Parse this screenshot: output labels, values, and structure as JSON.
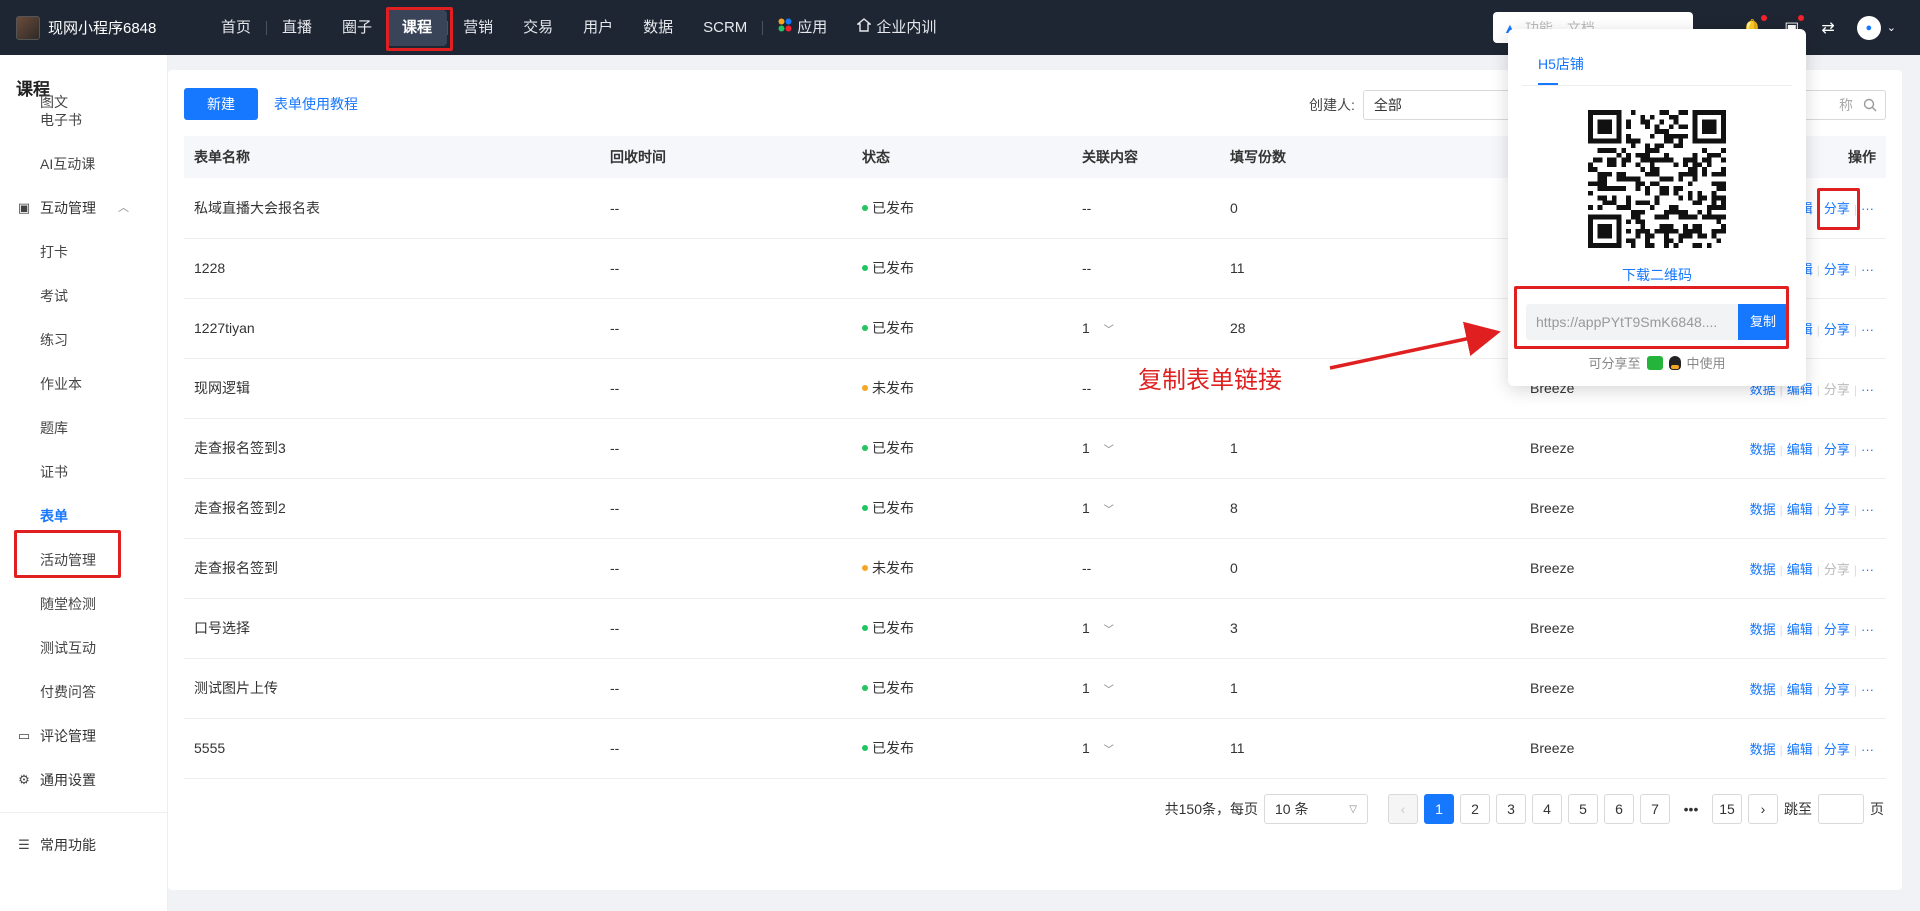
{
  "app": {
    "name": "现网小程序6848"
  },
  "nav": {
    "items": [
      {
        "label": "首页"
      },
      {
        "label": "直播"
      },
      {
        "label": "圈子"
      },
      {
        "label": "课程"
      },
      {
        "label": "营销"
      },
      {
        "label": "交易"
      },
      {
        "label": "用户"
      },
      {
        "label": "数据"
      },
      {
        "label": "SCRM"
      },
      {
        "label": "应用"
      },
      {
        "label": "企业内训"
      }
    ],
    "active": "课程",
    "search_placeholder": "功能、文档"
  },
  "sidebar": {
    "title": "课程",
    "items_top": [
      "图文",
      "电子书",
      "AI互动课"
    ],
    "group1": {
      "label": "互动管理"
    },
    "items_group1": [
      "打卡",
      "考试",
      "练习",
      "作业本",
      "题库",
      "证书",
      "表单",
      "活动管理",
      "随堂检测",
      "测试互动",
      "付费问答"
    ],
    "active": "表单",
    "group2": {
      "label": "评论管理"
    },
    "group3": {
      "label": "通用设置"
    },
    "group4": {
      "label": "常用功能"
    }
  },
  "toolbar": {
    "new_label": "新建",
    "tutorial_link": "表单使用教程",
    "creator_label": "创建人:",
    "creator_value": "全部",
    "search_placeholder": "称"
  },
  "table": {
    "headers": [
      "表单名称",
      "回收时间",
      "状态",
      "关联内容",
      "填写份数",
      "",
      "操作"
    ],
    "rows": [
      {
        "name": "私域直播大会报名表",
        "time": "--",
        "status": "已发布",
        "published": true,
        "related": "--",
        "count": "0",
        "creator": "",
        "share_enabled": true
      },
      {
        "name": "1228",
        "time": "--",
        "status": "已发布",
        "published": true,
        "related": "--",
        "count": "11",
        "creator": "",
        "share_enabled": true
      },
      {
        "name": "1227tiyan",
        "time": "--",
        "status": "已发布",
        "published": true,
        "related": "1",
        "count": "28",
        "creator": "",
        "share_enabled": true
      },
      {
        "name": "现网逻辑",
        "time": "--",
        "status": "未发布",
        "published": false,
        "related": "--",
        "count": "",
        "creator": "Breeze",
        "share_enabled": false
      },
      {
        "name": "走查报名签到3",
        "time": "--",
        "status": "已发布",
        "published": true,
        "related": "1",
        "count": "1",
        "creator": "Breeze",
        "share_enabled": true
      },
      {
        "name": "走查报名签到2",
        "time": "--",
        "status": "已发布",
        "published": true,
        "related": "1",
        "count": "8",
        "creator": "Breeze",
        "share_enabled": true
      },
      {
        "name": "走查报名签到",
        "time": "--",
        "status": "未发布",
        "published": false,
        "related": "--",
        "count": "0",
        "creator": "Breeze",
        "share_enabled": false
      },
      {
        "name": "口号选择",
        "time": "--",
        "status": "已发布",
        "published": true,
        "related": "1",
        "count": "3",
        "creator": "Breeze",
        "share_enabled": true
      },
      {
        "name": "测试图片上传",
        "time": "--",
        "status": "已发布",
        "published": true,
        "related": "1",
        "count": "1",
        "creator": "Breeze",
        "share_enabled": true
      },
      {
        "name": "5555",
        "time": "--",
        "status": "已发布",
        "published": true,
        "related": "1",
        "count": "11",
        "creator": "Breeze",
        "share_enabled": true
      }
    ],
    "ops": {
      "data": "数据",
      "edit": "编辑",
      "share": "分享",
      "more": "···"
    }
  },
  "pagination": {
    "total_text": "共150条，每页",
    "page_size": "10 条",
    "pages": [
      "1",
      "2",
      "3",
      "4",
      "5",
      "6",
      "7"
    ],
    "ellipsis": "•••",
    "last": "15",
    "current": "1",
    "jump_label": "跳至",
    "page_suffix": "页"
  },
  "popover": {
    "tab": "H5店铺",
    "download": "下载二维码",
    "url": "https://appPYtT9SmK6848....",
    "copy": "复制",
    "share_prefix": "可分享至",
    "share_suffix": "中使用"
  },
  "annotation": {
    "text": "复制表单链接"
  },
  "colors": {
    "primary": "#1677ff",
    "nav_bg": "#1f2633",
    "published": "#22c55e",
    "unpublished": "#f5a623",
    "annotation": "#e02020"
  }
}
